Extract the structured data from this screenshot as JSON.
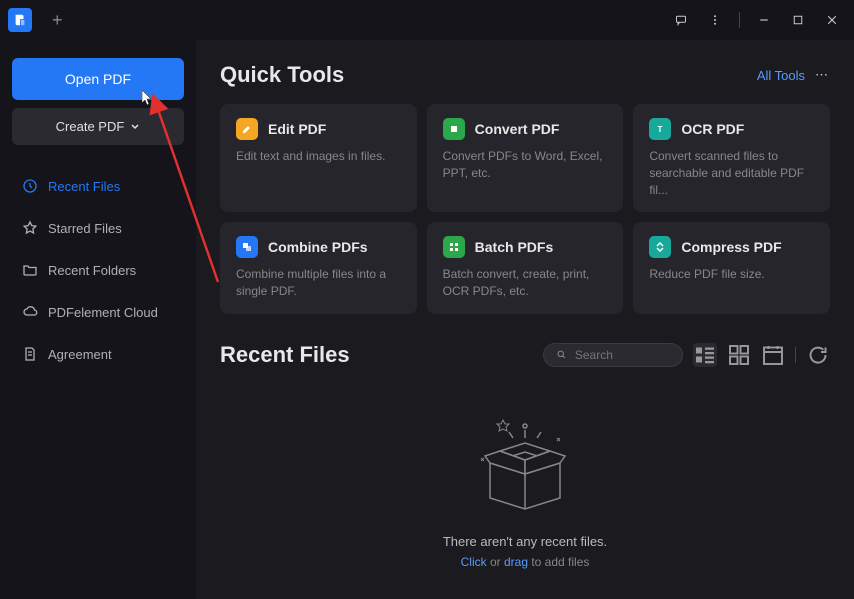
{
  "titlebar": {
    "new_tab_tooltip": "+"
  },
  "sidebar": {
    "open_pdf": "Open PDF",
    "create_pdf": "Create PDF",
    "nav": [
      {
        "label": "Recent Files",
        "icon": "clock-icon",
        "active": true
      },
      {
        "label": "Starred Files",
        "icon": "star-icon",
        "active": false
      },
      {
        "label": "Recent Folders",
        "icon": "folder-icon",
        "active": false
      },
      {
        "label": "PDFelement Cloud",
        "icon": "cloud-icon",
        "active": false
      },
      {
        "label": "Agreement",
        "icon": "document-icon",
        "active": false
      }
    ]
  },
  "quick_tools": {
    "title": "Quick Tools",
    "all_tools": "All Tools",
    "cards": [
      {
        "name": "Edit PDF",
        "desc": "Edit text and images in files.",
        "icon_color": "orange",
        "icon": "edit-icon"
      },
      {
        "name": "Convert PDF",
        "desc": "Convert PDFs to Word, Excel, PPT, etc.",
        "icon_color": "green",
        "icon": "convert-icon"
      },
      {
        "name": "OCR PDF",
        "desc": "Convert scanned files to searchable and editable PDF fil...",
        "icon_color": "teal",
        "icon": "ocr-icon"
      },
      {
        "name": "Combine PDFs",
        "desc": "Combine multiple files into a single PDF.",
        "icon_color": "blue",
        "icon": "combine-icon"
      },
      {
        "name": "Batch PDFs",
        "desc": "Batch convert, create, print, OCR PDFs, etc.",
        "icon_color": "green",
        "icon": "batch-icon"
      },
      {
        "name": "Compress PDF",
        "desc": "Reduce PDF file size.",
        "icon_color": "teal",
        "icon": "compress-icon"
      }
    ]
  },
  "recent_files": {
    "title": "Recent Files",
    "search_placeholder": "Search",
    "empty_message": "There aren't any recent files.",
    "empty_hint_click": "Click",
    "empty_hint_or": " or ",
    "empty_hint_drag": "drag",
    "empty_hint_rest": " to add files"
  }
}
